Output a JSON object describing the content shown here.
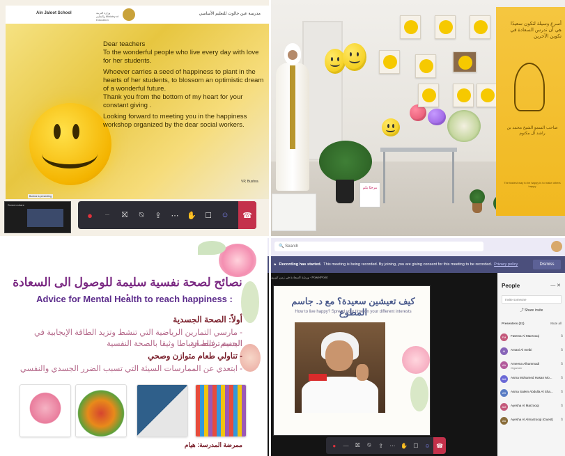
{
  "q1": {
    "school_en": "Ain Jaloot School",
    "school_ar": "مدرسة عين جالوت للتعليم الأساسي",
    "ministry": "وزارة التربية والتعليم Ministry of Education",
    "paragraphs": [
      "Dear teachers",
      "To the wonderful people  who live every day with love for her students.",
      "Whoever carries a seed of happiness to plant in the hearts of her students, to blossom an optimistic dream of a wonderful future.",
      "Thank you from the bottom of my heart for your constant giving .",
      "Looking forward to meeting you in the happiness workshop organized by the dear  social workers."
    ],
    "signature": "VP, Bushra",
    "caption": "Bushra is presenting",
    "thumb_label": "Screen share"
  },
  "q2": {
    "banner_title": "أسرع وسيلة لتكون سعيدًا هي أن تدرس السعادة في تكوين الآخرين",
    "banner_sub": "صاحب السمو الشيخ محمد بن راشد آل مكتوم",
    "banner_mini": "The fastest way to be happy is to make others happy",
    "card_text": "مرحبًا بكم"
  },
  "q3": {
    "title_ar": "نصائح لصحة نفسية سليمة للوصول الى السعادة :",
    "title_en": "Advice for Mental Health to reach happiness :",
    "section1": "أولاً: الصحة الجسدية",
    "line1": "- مارسي التمارين الرياضية التي تنشط وتزيد الطاقة الإيجابية في الجسم، فالصحة",
    "line2": "البدنية ترتبط ارتباطا وثيقا بالصحة النفسية",
    "line3": "- تناولي طعام متوازن وصحي",
    "line4": "- ابتعدي عن الممارسات السيئة التي تسبب الضرر الجسدي والنفسي",
    "footer": "ممرضة المدرسة: هيام"
  },
  "q4": {
    "search_placeholder": "Search",
    "recording_bold": "Recording has started.",
    "recording_text": "This meeting is being recorded. By joining, you are giving consent for this meeting to be recorded.",
    "privacy_link": "Privacy policy",
    "dismiss": "Dismiss",
    "slide_bar": "ورشة السعادة في زمن كورونا - PowerPoint",
    "slide_title_ar": "كيف تعيشين سعيدة؟ مع د. جاسم المطوع",
    "slide_title_en": "How to live happy? Spread your time on your different interests",
    "people_title": "People",
    "invite_placeholder": "Invite someone",
    "share_invite": "Share invite",
    "presenters_label": "Presenters (31)",
    "mute_all": "Mute all",
    "participants": [
      {
        "initials": "FM",
        "name": "Fatema Al Marzooqi",
        "role": "",
        "color": "#c45a7c"
      },
      {
        "initials": "AI",
        "name": "Amani Al Ineibi",
        "role": "",
        "color": "#8764b8"
      },
      {
        "initials": "AA",
        "name": "Ameena Alhammadi",
        "role": "Organizer",
        "color": "#b35c9c"
      },
      {
        "initials": "AM",
        "name": "Asma Mohamed Hasan Mo...",
        "role": "",
        "color": "#6b69d6"
      },
      {
        "initials": "AS",
        "name": "Asma Salem Abdulla Al Sha...",
        "role": "",
        "color": "#5a7dc4"
      },
      {
        "initials": "AM",
        "name": "Ayesha Al Marzooqi",
        "role": "",
        "color": "#c45a7c"
      },
      {
        "initials": "AA",
        "name": "Ayesha Al Almarzooqi (Guest)",
        "role": "",
        "color": "#8a6d3b"
      }
    ]
  }
}
